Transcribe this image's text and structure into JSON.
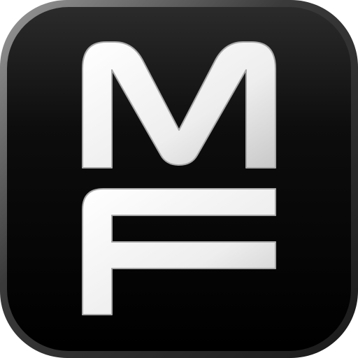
{
  "app_icon": {
    "logo_lettering": "MF",
    "background_color": "#050505",
    "border_color": "#5a5a5a",
    "glyph_color": "#f2f2f2",
    "glyph_shade_color": "#bdbdbd"
  }
}
